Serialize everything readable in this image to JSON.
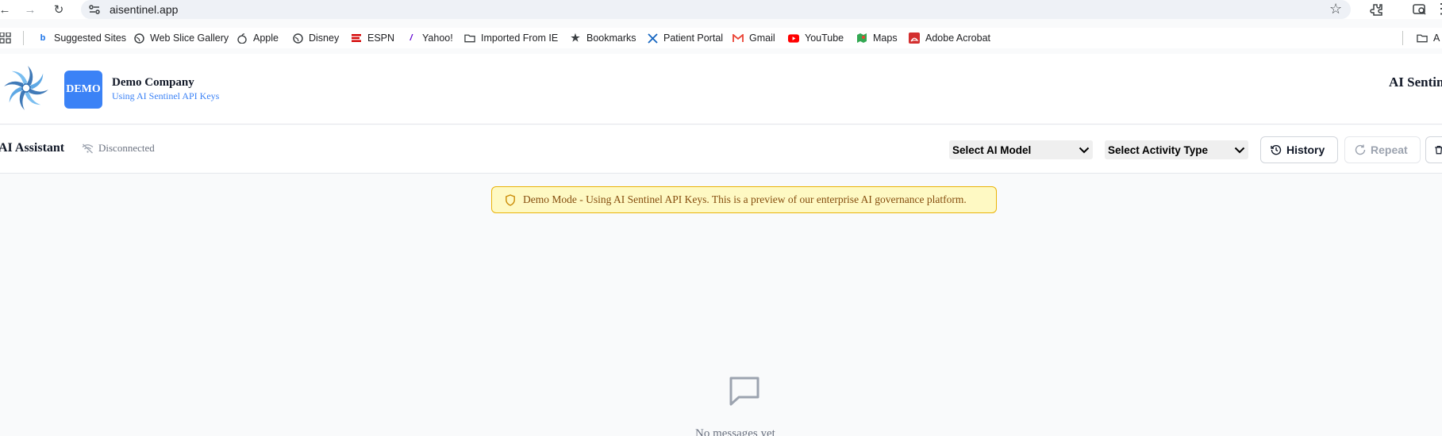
{
  "browser": {
    "url": "aisentinel.app"
  },
  "bookmarks": [
    {
      "label": "Suggested Sites",
      "icon": "bing-icon",
      "color": "#1a73e8"
    },
    {
      "label": "Web Slice Gallery",
      "icon": "globe-icon",
      "color": "#3c4043"
    },
    {
      "label": "Apple",
      "icon": "apple-icon",
      "color": "#3c4043"
    },
    {
      "label": "Disney",
      "icon": "globe-icon",
      "color": "#3c4043"
    },
    {
      "label": "ESPN",
      "icon": "espn-icon",
      "color": "#d50a0a"
    },
    {
      "label": "Yahoo!",
      "icon": "yahoo-icon",
      "color": "#6001d2"
    },
    {
      "label": "Imported From IE",
      "icon": "folder-icon",
      "color": "#3c4043"
    },
    {
      "label": "Bookmarks",
      "icon": "star-icon",
      "color": "#3c4043"
    },
    {
      "label": "Patient Portal",
      "icon": "x-icon",
      "color": "#1565c0"
    },
    {
      "label": "Gmail",
      "icon": "gmail-icon",
      "color": "#ea4335"
    },
    {
      "label": "YouTube",
      "icon": "youtube-icon",
      "color": "#ff0000"
    },
    {
      "label": "Maps",
      "icon": "maps-icon",
      "color": "#34a853"
    },
    {
      "label": "Adobe Acrobat",
      "icon": "acrobat-icon",
      "color": "#d32f2f"
    }
  ],
  "bookmarks_overflow": {
    "label": "A"
  },
  "header": {
    "badge": "DEMO",
    "company_name": "Demo Company",
    "company_sub": "Using AI Sentinel API Keys",
    "brand_title": "AI Sentinel"
  },
  "toolbar": {
    "title": "AI Assistant",
    "status": "Disconnected",
    "model_select": "Select AI Model",
    "activity_select": "Select Activity Type",
    "history_label": "History",
    "repeat_label": "Repeat"
  },
  "main": {
    "banner": "Demo Mode - Using AI Sentinel API Keys. This is a preview of our enterprise AI governance platform.",
    "empty_text": "No messages yet"
  },
  "colors": {
    "accent": "#3b82f6",
    "banner_bg": "#fef9c3",
    "banner_border": "#eab308",
    "banner_text": "#854d0e"
  }
}
